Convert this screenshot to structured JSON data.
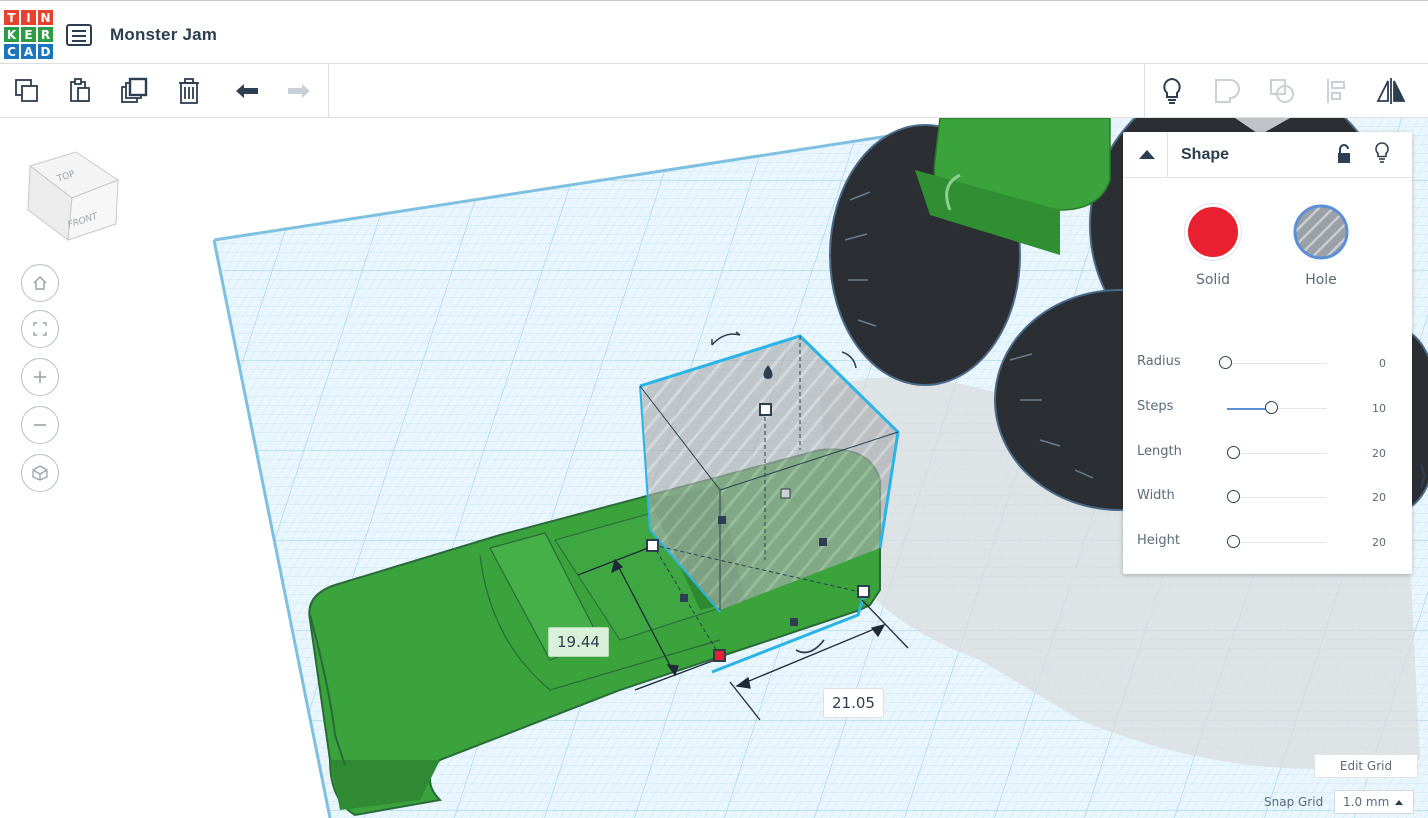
{
  "app": {
    "logo_letters": [
      "T",
      "I",
      "N",
      "K",
      "E",
      "R",
      "C",
      "A",
      "D"
    ],
    "logo_colors": [
      "#e8412f",
      "#e8412f",
      "#e8412f",
      "#2c9d44",
      "#2c9d44",
      "#2c9d44",
      "#1b75bc",
      "#1b75bc",
      "#1b75bc"
    ],
    "document_title": "Monster Jam"
  },
  "toolbar": {
    "left_tools": [
      "copy-icon",
      "paste-icon",
      "duplicate-icon",
      "trash-icon",
      "undo-icon",
      "redo-icon"
    ],
    "right_tools": [
      "lightbulb-icon",
      "group-icon",
      "ungroup-icon",
      "align-icon",
      "mirror-icon"
    ]
  },
  "viewcube": {
    "top_label": "TOP",
    "front_label": "FRONT"
  },
  "dimensions": {
    "width_label": "19.44",
    "length_label": "21.05"
  },
  "shape_panel": {
    "title": "Shape",
    "solid_label": "Solid",
    "hole_label": "Hole",
    "solid_color": "#e8202f",
    "properties": [
      {
        "label": "Radius",
        "value": "0",
        "fraction": 0.0
      },
      {
        "label": "Steps",
        "value": "10",
        "fraction": 0.45
      },
      {
        "label": "Length",
        "value": "20",
        "fraction": 0.06
      },
      {
        "label": "Width",
        "value": "20",
        "fraction": 0.06
      },
      {
        "label": "Height",
        "value": "20",
        "fraction": 0.06
      }
    ]
  },
  "grid": {
    "edit_grid_label": "Edit Grid",
    "snap_grid_label": "Snap Grid",
    "snap_grid_value": "1.0 mm"
  },
  "colors": {
    "accent": "#2c3e50",
    "grid": "#d6ecf7",
    "car_green": "#3aa33c",
    "selection": "#2ab4e6"
  }
}
